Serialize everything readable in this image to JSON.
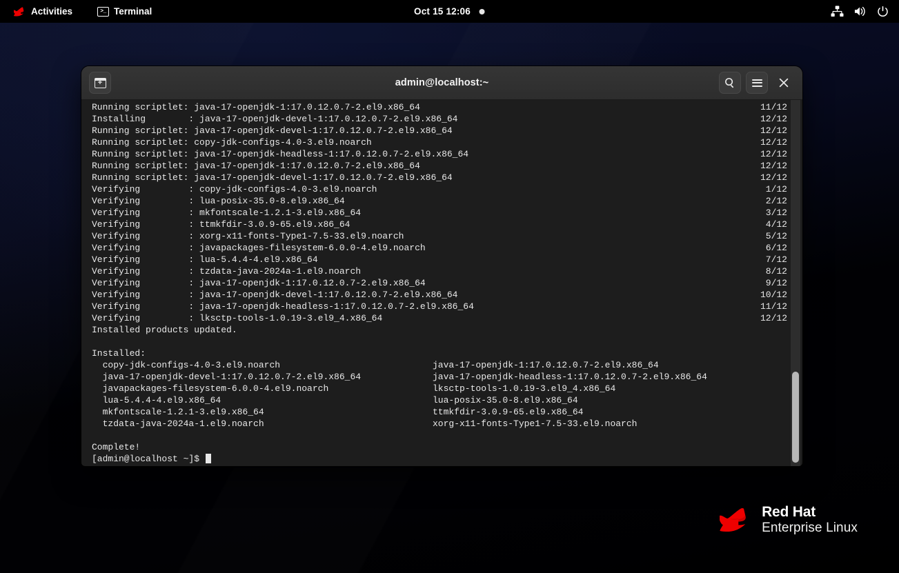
{
  "topbar": {
    "activities_label": "Activities",
    "app_label": "Terminal",
    "app_icon": "terminal-icon",
    "logo_icon": "redhat-logo-icon",
    "clock": "Oct 15  12:06",
    "notification_icon": "notification-dot-icon",
    "network_icon": "network-wired-icon",
    "volume_icon": "volume-icon",
    "power_icon": "power-icon"
  },
  "window": {
    "title": "admin@localhost:~",
    "new_tab_icon": "new-tab-icon",
    "search_icon": "search-icon",
    "menu_icon": "hamburger-menu-icon",
    "close_icon": "close-icon"
  },
  "terminal": {
    "lines": [
      {
        "text": "Running scriptlet: java-17-openjdk-1:17.0.12.0.7-2.el9.x86_64",
        "count": "11/12"
      },
      {
        "text": "Installing        : java-17-openjdk-devel-1:17.0.12.0.7-2.el9.x86_64",
        "count": "12/12"
      },
      {
        "text": "Running scriptlet: java-17-openjdk-devel-1:17.0.12.0.7-2.el9.x86_64",
        "count": "12/12"
      },
      {
        "text": "Running scriptlet: copy-jdk-configs-4.0-3.el9.noarch",
        "count": "12/12"
      },
      {
        "text": "Running scriptlet: java-17-openjdk-headless-1:17.0.12.0.7-2.el9.x86_64",
        "count": "12/12"
      },
      {
        "text": "Running scriptlet: java-17-openjdk-1:17.0.12.0.7-2.el9.x86_64",
        "count": "12/12"
      },
      {
        "text": "Running scriptlet: java-17-openjdk-devel-1:17.0.12.0.7-2.el9.x86_64",
        "count": "12/12"
      },
      {
        "text": "Verifying         : copy-jdk-configs-4.0-3.el9.noarch",
        "count": "1/12"
      },
      {
        "text": "Verifying         : lua-posix-35.0-8.el9.x86_64",
        "count": "2/12"
      },
      {
        "text": "Verifying         : mkfontscale-1.2.1-3.el9.x86_64",
        "count": "3/12"
      },
      {
        "text": "Verifying         : ttmkfdir-3.0.9-65.el9.x86_64",
        "count": "4/12"
      },
      {
        "text": "Verifying         : xorg-x11-fonts-Type1-7.5-33.el9.noarch",
        "count": "5/12"
      },
      {
        "text": "Verifying         : javapackages-filesystem-6.0.0-4.el9.noarch",
        "count": "6/12"
      },
      {
        "text": "Verifying         : lua-5.4.4-4.el9.x86_64",
        "count": "7/12"
      },
      {
        "text": "Verifying         : tzdata-java-2024a-1.el9.noarch",
        "count": "8/12"
      },
      {
        "text": "Verifying         : java-17-openjdk-1:17.0.12.0.7-2.el9.x86_64",
        "count": "9/12"
      },
      {
        "text": "Verifying         : java-17-openjdk-devel-1:17.0.12.0.7-2.el9.x86_64",
        "count": "10/12"
      },
      {
        "text": "Verifying         : java-17-openjdk-headless-1:17.0.12.0.7-2.el9.x86_64",
        "count": "11/12"
      },
      {
        "text": "Verifying         : lksctp-tools-1.0.19-3.el9_4.x86_64",
        "count": "12/12"
      }
    ],
    "status_line": "Installed products updated.",
    "installed_header": "Installed:",
    "installed_packages": [
      {
        "col1": "  copy-jdk-configs-4.0-3.el9.noarch",
        "col2": "java-17-openjdk-1:17.0.12.0.7-2.el9.x86_64"
      },
      {
        "col1": "  java-17-openjdk-devel-1:17.0.12.0.7-2.el9.x86_64",
        "col2": "java-17-openjdk-headless-1:17.0.12.0.7-2.el9.x86_64"
      },
      {
        "col1": "  javapackages-filesystem-6.0.0-4.el9.noarch",
        "col2": "lksctp-tools-1.0.19-3.el9_4.x86_64"
      },
      {
        "col1": "  lua-5.4.4-4.el9.x86_64",
        "col2": "lua-posix-35.0-8.el9.x86_64"
      },
      {
        "col1": "  mkfontscale-1.2.1-3.el9.x86_64",
        "col2": "ttmkfdir-3.0.9-65.el9.x86_64"
      },
      {
        "col1": "  tzdata-java-2024a-1.el9.noarch",
        "col2": "xorg-x11-fonts-Type1-7.5-33.el9.noarch"
      }
    ],
    "complete_line": "Complete!",
    "prompt": "[admin@localhost ~]$ "
  },
  "branding": {
    "line1": "Red Hat",
    "line2": "Enterprise Linux",
    "hat_icon": "redhat-fedora-icon",
    "hat_color": "#ee0000"
  },
  "colors": {
    "accent": "#ee0000",
    "terminal_bg": "#1d1d1d",
    "titlebar_bg": "#303030",
    "text": "#e8e8e8"
  }
}
